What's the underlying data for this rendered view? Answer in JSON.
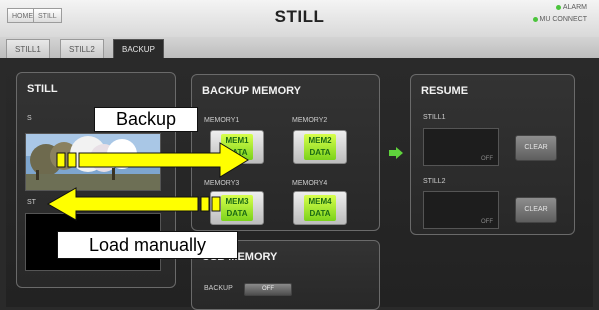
{
  "header": {
    "home_label": "HOME",
    "breadcrumb_label": "STILL",
    "title": "STILL",
    "status": [
      {
        "label": "ALARM",
        "color": "#4bc43c"
      },
      {
        "label": "MU CONNECT",
        "color": "#4bc43c"
      }
    ]
  },
  "tabs": [
    {
      "label": "STILL1",
      "active": false
    },
    {
      "label": "STILL2",
      "active": false
    },
    {
      "label": "BACKUP",
      "active": true
    }
  ],
  "still_panel": {
    "title": "STILL",
    "still1_label": "S",
    "still2_label": "ST"
  },
  "backup_memory": {
    "title": "BACKUP MEMORY",
    "slots": [
      {
        "label": "MEMORY1",
        "button_line1": "MEM1",
        "button_line2": "DATA"
      },
      {
        "label": "MEMORY2",
        "button_line1": "MEM2",
        "button_line2": "DATA"
      },
      {
        "label": "MEMORY3",
        "button_line1": "MEM3",
        "button_line2": "DATA"
      },
      {
        "label": "MEMORY4",
        "button_line1": "MEM4",
        "button_line2": "DATA"
      }
    ]
  },
  "resume": {
    "title": "RESUME",
    "still1_label": "STILL1",
    "still1_status": "OFF",
    "still2_label": "STILL2",
    "still2_status": "OFF",
    "clear_label": "CLEAR"
  },
  "usb_memory": {
    "title": "USB MEMORY",
    "backup_label": "BACKUP",
    "toggle_label": "OFF"
  },
  "annotations": {
    "backup_label": "Backup",
    "load_label": "Load manually",
    "arrow_color": "#ffff00"
  }
}
